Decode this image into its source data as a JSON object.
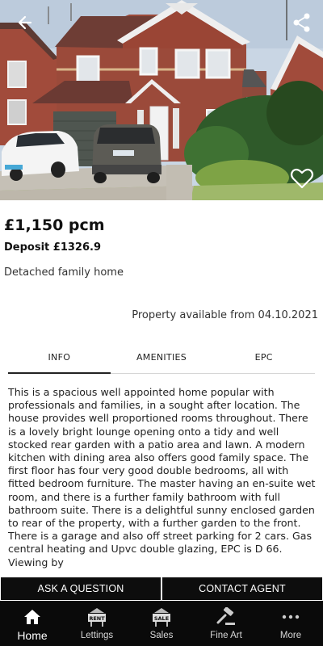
{
  "listing": {
    "price": "£1,150 pcm",
    "deposit": "Deposit £1326.9",
    "property_type": "Detached family home",
    "availability": "Property available from 04.10.2021"
  },
  "tabs": [
    {
      "label": "INFO",
      "active": true
    },
    {
      "label": "AMENITIES",
      "active": false
    },
    {
      "label": "EPC",
      "active": false
    }
  ],
  "description": "This is a spacious well appointed home popular with professionals and families, in a sought after location. The house provides well proportioned rooms throughout. There is a lovely bright lounge opening onto a tidy and well stocked rear garden with a patio area and lawn.  A modern kitchen with dining area also offers good family space. The first floor has four very good double bedrooms, all with fitted bedroom furniture.  The master having an en-suite wet room, and there is a further family bathroom with full  bathroom suite. There is a delightful sunny enclosed garden to rear of the property, with a further garden to the front.  There is a garage and also off street parking for 2 cars. Gas central heating and Upvc double glazing, EPC is D 66.  Viewing by",
  "actions": {
    "ask": "ASK A QUESTION",
    "contact": "CONTACT AGENT"
  },
  "hero_icons": [
    "back-arrow-icon",
    "share-icon",
    "heart-icon"
  ],
  "nav": {
    "items": [
      {
        "label": "Home",
        "icon": "home-icon",
        "active": true
      },
      {
        "label": "Lettings",
        "icon": "rent-sign-icon",
        "active": false
      },
      {
        "label": "Sales",
        "icon": "sale-sign-icon",
        "active": false
      },
      {
        "label": "Fine Art",
        "icon": "gavel-icon",
        "active": false
      },
      {
        "label": "More",
        "icon": "more-dots-icon",
        "active": false
      }
    ],
    "rent_sign_text": "RENT",
    "sale_sign_text": "SALE"
  },
  "colors": {
    "nav_background": "#0a0a0a",
    "button_background": "#0d0d0d",
    "brick": "#9b4a3a"
  }
}
